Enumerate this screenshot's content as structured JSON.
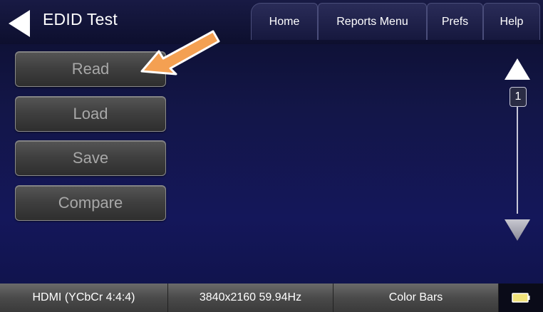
{
  "header": {
    "title": "EDID Test",
    "tabs": [
      {
        "label": "Home"
      },
      {
        "label": "Reports Menu"
      },
      {
        "label": "Prefs"
      },
      {
        "label": "Help"
      }
    ]
  },
  "side_buttons": [
    {
      "label": "Read"
    },
    {
      "label": "Load"
    },
    {
      "label": "Save"
    },
    {
      "label": "Compare"
    }
  ],
  "scroll": {
    "page": "1"
  },
  "status_bar": {
    "signal": "HDMI (YCbCr 4:4:4)",
    "resolution": "3840x2160 59.94Hz",
    "pattern": "Color Bars"
  },
  "colors": {
    "background": "#14175a",
    "button": "#3e3e3e",
    "button_text": "#a8a8a8",
    "annotation_arrow": "#f4a052"
  },
  "icons": {
    "back": "left-triangle",
    "scroll_up": "up-triangle",
    "scroll_down": "down-triangle",
    "battery": "battery"
  }
}
